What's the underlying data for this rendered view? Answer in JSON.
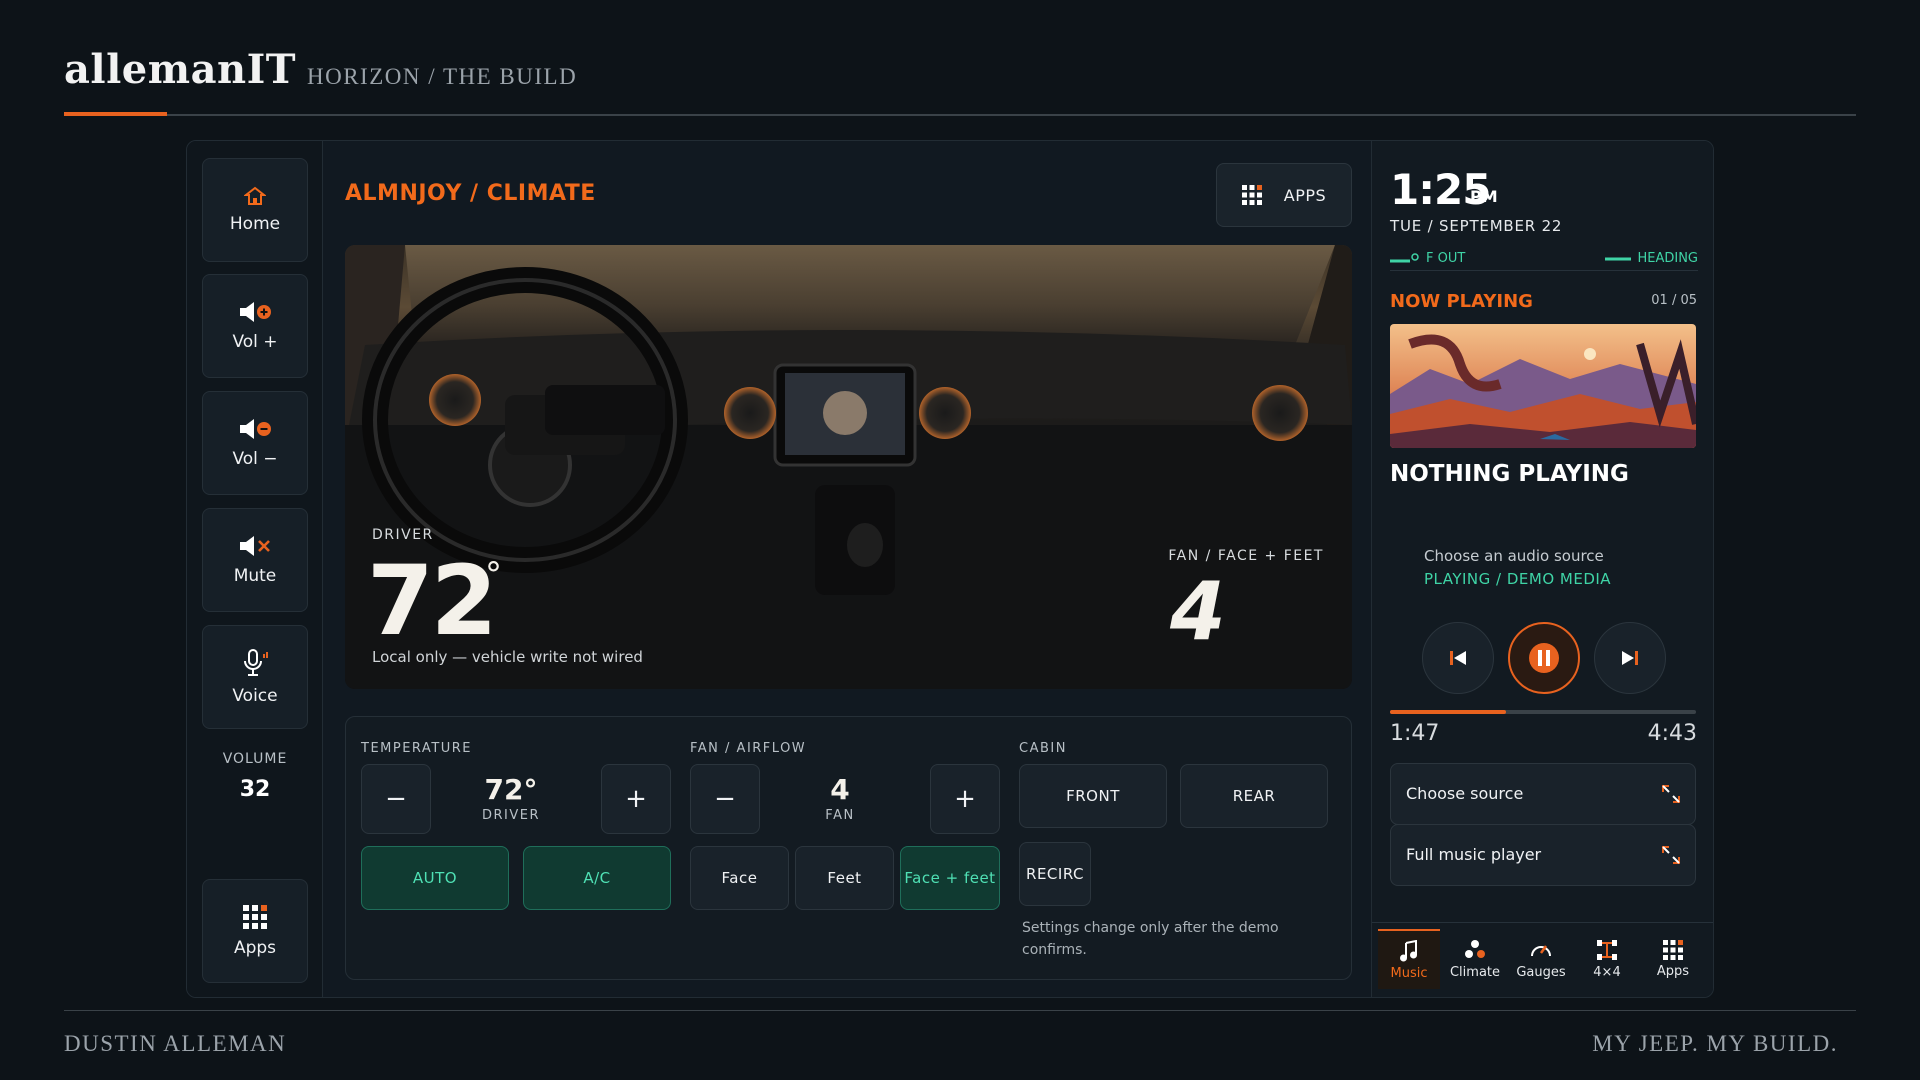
{
  "brand": {
    "logo": "allemanIT",
    "subtitle": "HORIZON / THE BUILD",
    "footer_left": "DUSTIN ALLEMAN",
    "footer_right": "MY JEEP. MY BUILD."
  },
  "colors": {
    "accent": "#e8621f",
    "teal": "#3fd4a6",
    "background": "#0d1318",
    "panel": "#111921"
  },
  "sidebar": {
    "items": [
      {
        "label": "Home",
        "icon": "home-icon"
      },
      {
        "label": "Vol +",
        "icon": "volume-up-icon"
      },
      {
        "label": "Vol −",
        "icon": "volume-down-icon"
      },
      {
        "label": "Mute",
        "icon": "mute-icon"
      },
      {
        "label": "Voice",
        "icon": "microphone-icon"
      }
    ],
    "volume_label": "VOLUME",
    "volume_value": "32",
    "apps_label": "Apps"
  },
  "main": {
    "title": "ALMNJOY / CLIMATE",
    "apps_button": "APPS",
    "hero": {
      "driver_label": "DRIVER",
      "driver_temp": "72",
      "driver_temp_unit": "°",
      "driver_note": "Local only — vehicle write not wired",
      "fan_label": "FAN / FACE + FEET",
      "fan_value": "4"
    },
    "controls": {
      "temperature_label": "TEMPERATURE",
      "temp_minus": "−",
      "temp_value": "72°",
      "temp_sub": "DRIVER",
      "temp_plus": "+",
      "auto": "AUTO",
      "ac": "A/C",
      "fan_label": "FAN / AIRFLOW",
      "fan_minus": "−",
      "fan_value": "4",
      "fan_sub": "FAN",
      "fan_plus": "+",
      "face": "Face",
      "feet": "Feet",
      "face_feet": "Face + feet",
      "cabin_label": "CABIN",
      "front": "FRONT",
      "rear": "REAR",
      "recirc": "RECIRC",
      "note": "Settings change only after the demo confirms."
    }
  },
  "right": {
    "time": "1:25",
    "ampm": "PM",
    "date": "TUE / SEPTEMBER 22",
    "stat_left": "F OUT",
    "stat_right": "HEADING",
    "now_playing": "NOW PLAYING",
    "track_count": "01 / 05",
    "track_title": "NOTHING PLAYING",
    "source_hint": "Choose an audio source",
    "source_state": "PLAYING / DEMO MEDIA",
    "progress": 0.38,
    "time_current": "1:47",
    "time_total": "4:43",
    "choose_source": "Choose source",
    "full_player": "Full music player",
    "tabs": [
      {
        "label": "Music",
        "icon": "music-note-icon",
        "active": true
      },
      {
        "label": "Climate",
        "icon": "fan-icon",
        "active": false
      },
      {
        "label": "Gauges",
        "icon": "gauge-icon",
        "active": false
      },
      {
        "label": "4×4",
        "icon": "drivetrain-icon",
        "active": false
      },
      {
        "label": "Apps",
        "icon": "apps-grid-icon",
        "active": false
      }
    ]
  }
}
